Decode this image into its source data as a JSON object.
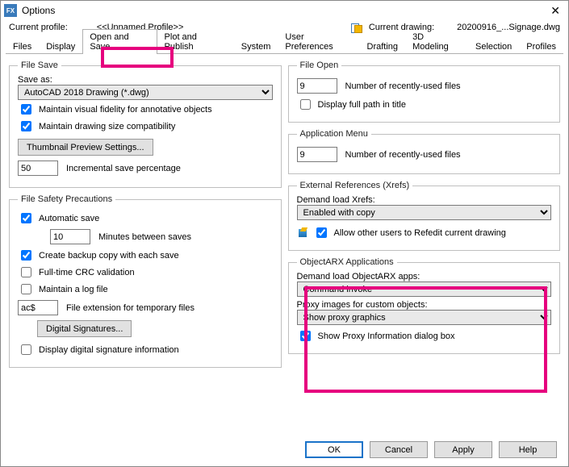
{
  "title": "Options",
  "profile_label": "Current profile:",
  "profile_value": "<<Unnamed Profile>>",
  "drawing_label": "Current drawing:",
  "drawing_value": "20200916_...Signage.dwg",
  "tabs": [
    "Files",
    "Display",
    "Open and Save",
    "Plot and Publish",
    "System",
    "User Preferences",
    "Drafting",
    "3D Modeling",
    "Selection",
    "Profiles"
  ],
  "fileSave": {
    "legend": "File Save",
    "saveAsLabel": "Save as:",
    "saveAsValue": "AutoCAD 2018 Drawing (*.dwg)",
    "maintainVisual": "Maintain visual fidelity for annotative objects",
    "maintainSize": "Maintain drawing size compatibility",
    "thumbBtn": "Thumbnail Preview Settings...",
    "incSaveVal": "50",
    "incSaveLabel": "Incremental save percentage"
  },
  "safety": {
    "legend": "File Safety Precautions",
    "autosave": "Automatic save",
    "minVal": "10",
    "minLabel": "Minutes between saves",
    "backup": "Create backup copy with each save",
    "crc": "Full-time CRC validation",
    "logfile": "Maintain a log file",
    "extVal": "ac$",
    "extLabel": "File extension for temporary files",
    "digSigBtn": "Digital Signatures...",
    "dispSig": "Display digital signature information"
  },
  "fileOpen": {
    "legend": "File Open",
    "recentVal": "9",
    "recentLabel": "Number of recently-used files",
    "fullPath": "Display full path in title"
  },
  "appMenu": {
    "legend": "Application Menu",
    "recentVal": "9",
    "recentLabel": "Number of recently-used files"
  },
  "xrefs": {
    "legend": "External References (Xrefs)",
    "demandLabel": "Demand load Xrefs:",
    "demandValue": "Enabled with copy",
    "allowRefedit": "Allow other users to Refedit current drawing"
  },
  "arx": {
    "legend": "ObjectARX Applications",
    "demandLabel": "Demand load ObjectARX apps:",
    "demandValue": "Command invoke",
    "proxyLabel": "Proxy images for custom objects:",
    "proxyValue": "Show proxy graphics",
    "showProxy": "Show Proxy Information dialog box"
  },
  "footer": {
    "ok": "OK",
    "cancel": "Cancel",
    "apply": "Apply",
    "help": "Help"
  }
}
